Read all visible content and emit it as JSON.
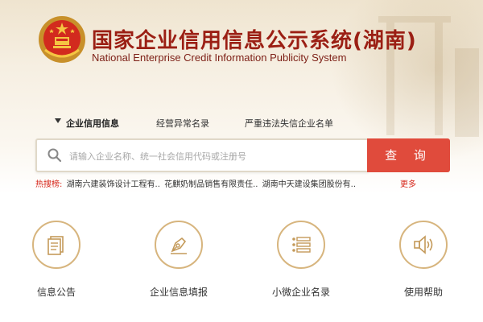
{
  "header": {
    "title_cn": "国家企业信用信息公示系统(湖南)",
    "title_en": "National Enterprise Credit Information Publicity System"
  },
  "tabs": [
    {
      "label": "企业信用信息",
      "active": true
    },
    {
      "label": "经营异常名录",
      "active": false
    },
    {
      "label": "严重违法失信企业名单",
      "active": false
    }
  ],
  "search": {
    "placeholder": "请输入企业名称、统一社会信用代码或注册号",
    "button_label": "查 询"
  },
  "hot_search": {
    "label": "热搜榜:",
    "items": [
      "湖南六建装饰设计工程有..",
      "花麒奶制品销售有限责任..",
      "湖南中天建设集团股份有.."
    ],
    "more_label": "更多"
  },
  "features": [
    {
      "label": "信息公告",
      "icon": "document-icon"
    },
    {
      "label": "企业信息填报",
      "icon": "pen-icon"
    },
    {
      "label": "小微企业名录",
      "icon": "list-icon"
    },
    {
      "label": "使用帮助",
      "icon": "speaker-icon"
    }
  ],
  "colors": {
    "brand_red": "#9b1f14",
    "accent_red": "#e04b3c",
    "gold": "#d7b57e"
  }
}
